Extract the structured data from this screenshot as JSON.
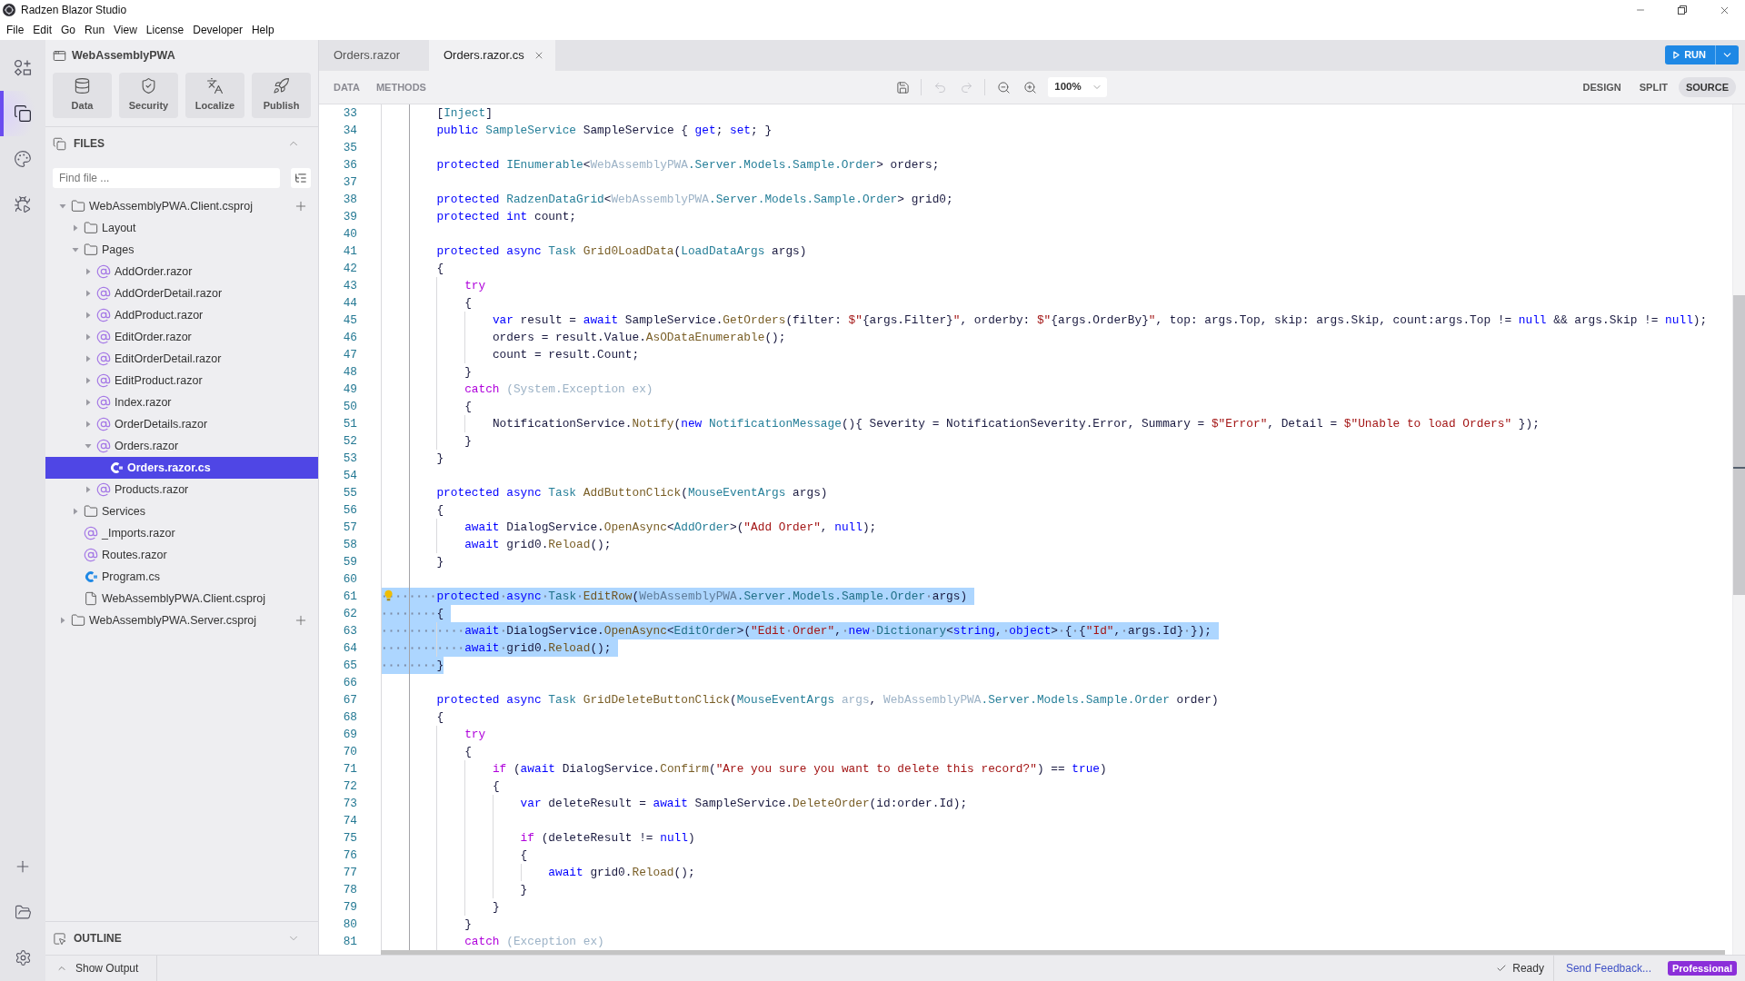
{
  "window": {
    "title": "Radzen Blazor Studio"
  },
  "menu": [
    "File",
    "Edit",
    "Go",
    "Run",
    "View",
    "License",
    "Developer",
    "Help"
  ],
  "activity_bar": {
    "items": [
      {
        "selected": false
      },
      {
        "selected": true
      },
      {
        "selected": false
      },
      {
        "selected": false
      }
    ]
  },
  "sidebar": {
    "project": "WebAssemblyPWA",
    "tools": [
      "Data",
      "Security",
      "Localize",
      "Publish"
    ],
    "files": {
      "title": "FILES",
      "expanded": true,
      "search": {
        "placeholder": "Find file ..."
      },
      "tree": [
        {
          "label": "WebAssemblyPWA.Client.csproj",
          "kind": "project",
          "expanded": true,
          "selected": false,
          "children": [
            {
              "label": "Layout",
              "kind": "folder",
              "expanded": false,
              "selected": false
            },
            {
              "label": "Pages",
              "kind": "folder",
              "expanded": true,
              "selected": false,
              "children": [
                {
                  "label": "AddOrder.razor",
                  "kind": "razor",
                  "expanded": false,
                  "selected": false
                },
                {
                  "label": "AddOrderDetail.razor",
                  "kind": "razor",
                  "expanded": false,
                  "selected": false
                },
                {
                  "label": "AddProduct.razor",
                  "kind": "razor",
                  "expanded": false,
                  "selected": false
                },
                {
                  "label": "EditOrder.razor",
                  "kind": "razor",
                  "expanded": false,
                  "selected": false
                },
                {
                  "label": "EditOrderDetail.razor",
                  "kind": "razor",
                  "expanded": false,
                  "selected": false
                },
                {
                  "label": "EditProduct.razor",
                  "kind": "razor",
                  "expanded": false,
                  "selected": false
                },
                {
                  "label": "Index.razor",
                  "kind": "razor",
                  "expanded": false,
                  "selected": false
                },
                {
                  "label": "OrderDetails.razor",
                  "kind": "razor",
                  "expanded": false,
                  "selected": false
                },
                {
                  "label": "Orders.razor",
                  "kind": "razor",
                  "expanded": true,
                  "selected": false,
                  "children": [
                    {
                      "label": "Orders.razor.cs",
                      "kind": "csharp",
                      "selected": true
                    }
                  ]
                },
                {
                  "label": "Products.razor",
                  "kind": "razor",
                  "expanded": false,
                  "selected": false
                }
              ]
            },
            {
              "label": "Services",
              "kind": "folder",
              "expanded": false,
              "selected": false
            },
            {
              "label": "_Imports.razor",
              "kind": "razor",
              "selected": false
            },
            {
              "label": "Routes.razor",
              "kind": "razor",
              "selected": false
            },
            {
              "label": "Program.cs",
              "kind": "csharp",
              "selected": false
            },
            {
              "label": "WebAssemblyPWA.Client.csproj",
              "kind": "file",
              "selected": false
            }
          ]
        },
        {
          "label": "WebAssemblyPWA.Server.csproj",
          "kind": "project",
          "expanded": false,
          "selected": false
        }
      ]
    },
    "outline": {
      "title": "OUTLINE",
      "expanded": false
    }
  },
  "editor": {
    "tabs": [
      {
        "label": "Orders.razor",
        "selected": false
      },
      {
        "label": "Orders.razor.cs",
        "selected": true
      }
    ],
    "run_button": {
      "label": "RUN"
    },
    "toolbar": {
      "links": [
        "DATA",
        "METHODS"
      ],
      "undo": {
        "disabled": true
      },
      "redo": {
        "disabled": true
      },
      "zoom": "100%",
      "views": [
        {
          "label": "DESIGN",
          "selected": false
        },
        {
          "label": "SPLIT",
          "selected": false
        },
        {
          "label": "SOURCE",
          "selected": true
        }
      ]
    },
    "lines": [
      {
        "number": "33",
        "selected": false,
        "lightbulb": false,
        "tokens": [
          {
            "kind": "plain",
            "text": "        ["
          },
          {
            "kind": "type",
            "text": "Inject"
          },
          {
            "kind": "plain",
            "text": "]"
          }
        ]
      },
      {
        "number": "34",
        "selected": false,
        "lightbulb": false,
        "tokens": [
          {
            "kind": "keyword",
            "text": "        public "
          },
          {
            "kind": "type",
            "text": "SampleService"
          },
          {
            "kind": "plain",
            "text": " SampleService { "
          },
          {
            "kind": "keyword",
            "text": "get"
          },
          {
            "kind": "plain",
            "text": "; "
          },
          {
            "kind": "keyword",
            "text": "set"
          },
          {
            "kind": "plain",
            "text": "; }"
          }
        ]
      },
      {
        "number": "35",
        "selected": false,
        "lightbulb": false
      },
      {
        "number": "36",
        "selected": false,
        "lightbulb": false,
        "tokens": [
          {
            "kind": "keyword",
            "text": "        protected "
          },
          {
            "kind": "type",
            "text": "IEnumerable"
          },
          {
            "kind": "plain",
            "text": "<"
          },
          {
            "kind": "faded",
            "text": "WebAssemblyPWA"
          },
          {
            "kind": "type",
            "text": ".Server.Models.Sample.Order"
          },
          {
            "kind": "plain",
            "text": "> orders;"
          }
        ]
      },
      {
        "number": "37",
        "selected": false,
        "lightbulb": false
      },
      {
        "number": "38",
        "selected": false,
        "lightbulb": false,
        "tokens": [
          {
            "kind": "keyword",
            "text": "        protected "
          },
          {
            "kind": "type",
            "text": "RadzenDataGrid"
          },
          {
            "kind": "plain",
            "text": "<"
          },
          {
            "kind": "faded",
            "text": "WebAssemblyPWA"
          },
          {
            "kind": "type",
            "text": ".Server.Models.Sample.Order"
          },
          {
            "kind": "plain",
            "text": "> grid0;"
          }
        ]
      },
      {
        "number": "39",
        "selected": false,
        "lightbulb": false,
        "tokens": [
          {
            "kind": "keyword",
            "text": "        protected int "
          },
          {
            "kind": "plain",
            "text": "count;"
          }
        ]
      },
      {
        "number": "40",
        "selected": false,
        "lightbulb": false
      },
      {
        "number": "41",
        "selected": false,
        "lightbulb": false,
        "tokens": [
          {
            "kind": "keyword",
            "text": "        protected async "
          },
          {
            "kind": "type",
            "text": "Task "
          },
          {
            "kind": "method",
            "text": "Grid0LoadData"
          },
          {
            "kind": "plain",
            "text": "("
          },
          {
            "kind": "type",
            "text": "LoadDataArgs"
          },
          {
            "kind": "plain",
            "text": " args)"
          }
        ]
      },
      {
        "number": "42",
        "selected": false,
        "lightbulb": false,
        "tokens": [
          {
            "kind": "plain",
            "text": "        {"
          }
        ]
      },
      {
        "number": "43",
        "selected": false,
        "lightbulb": false,
        "tokens": [
          {
            "kind": "control",
            "text": "            try"
          }
        ]
      },
      {
        "number": "44",
        "selected": false,
        "lightbulb": false,
        "tokens": [
          {
            "kind": "plain",
            "text": "            {"
          }
        ]
      },
      {
        "number": "45",
        "selected": false,
        "lightbulb": false,
        "tokens": [
          {
            "kind": "keyword",
            "text": "                var "
          },
          {
            "kind": "plain",
            "text": "result = "
          },
          {
            "kind": "keyword",
            "text": "await "
          },
          {
            "kind": "plain",
            "text": "SampleService."
          },
          {
            "kind": "method",
            "text": "GetOrders"
          },
          {
            "kind": "plain",
            "text": "(filter: "
          },
          {
            "kind": "string",
            "text": "$\""
          },
          {
            "kind": "plain",
            "text": "{args.Filter}"
          },
          {
            "kind": "string",
            "text": "\""
          },
          {
            "kind": "plain",
            "text": ", orderby: "
          },
          {
            "kind": "string",
            "text": "$\""
          },
          {
            "kind": "plain",
            "text": "{args.OrderBy}"
          },
          {
            "kind": "string",
            "text": "\""
          },
          {
            "kind": "plain",
            "text": ", top: args.Top, skip: args.Skip, count:args.Top != "
          },
          {
            "kind": "keyword",
            "text": "null"
          },
          {
            "kind": "plain",
            "text": " && args.Skip != "
          },
          {
            "kind": "keyword",
            "text": "null"
          },
          {
            "kind": "plain",
            "text": ");"
          }
        ]
      },
      {
        "number": "46",
        "selected": false,
        "lightbulb": false,
        "tokens": [
          {
            "kind": "plain",
            "text": "                orders = result.Value."
          },
          {
            "kind": "method",
            "text": "AsODataEnumerable"
          },
          {
            "kind": "plain",
            "text": "();"
          }
        ]
      },
      {
        "number": "47",
        "selected": false,
        "lightbulb": false,
        "tokens": [
          {
            "kind": "plain",
            "text": "                count = result.Count;"
          }
        ]
      },
      {
        "number": "48",
        "selected": false,
        "lightbulb": false,
        "tokens": [
          {
            "kind": "plain",
            "text": "            }"
          }
        ]
      },
      {
        "number": "49",
        "selected": false,
        "lightbulb": false,
        "tokens": [
          {
            "kind": "control",
            "text": "            catch "
          },
          {
            "kind": "faded",
            "text": "(System.Exception ex)"
          }
        ]
      },
      {
        "number": "50",
        "selected": false,
        "lightbulb": false,
        "tokens": [
          {
            "kind": "plain",
            "text": "            {"
          }
        ]
      },
      {
        "number": "51",
        "selected": false,
        "lightbulb": false,
        "tokens": [
          {
            "kind": "plain",
            "text": "                NotificationService."
          },
          {
            "kind": "method",
            "text": "Notify"
          },
          {
            "kind": "plain",
            "text": "("
          },
          {
            "kind": "keyword",
            "text": "new "
          },
          {
            "kind": "type",
            "text": "NotificationMessage"
          },
          {
            "kind": "plain",
            "text": "(){ Severity = NotificationSeverity.Error, Summary = "
          },
          {
            "kind": "string",
            "text": "$\"Error\""
          },
          {
            "kind": "plain",
            "text": ", Detail = "
          },
          {
            "kind": "string",
            "text": "$\"Unable to load Orders\""
          },
          {
            "kind": "plain",
            "text": " });"
          }
        ]
      },
      {
        "number": "52",
        "selected": false,
        "lightbulb": false,
        "tokens": [
          {
            "kind": "plain",
            "text": "            }"
          }
        ]
      },
      {
        "number": "53",
        "selected": false,
        "lightbulb": false,
        "tokens": [
          {
            "kind": "plain",
            "text": "        }"
          }
        ]
      },
      {
        "number": "54",
        "selected": false,
        "lightbulb": false
      },
      {
        "number": "55",
        "selected": false,
        "lightbulb": false,
        "tokens": [
          {
            "kind": "keyword",
            "text": "        protected async "
          },
          {
            "kind": "type",
            "text": "Task "
          },
          {
            "kind": "method",
            "text": "AddButtonClick"
          },
          {
            "kind": "plain",
            "text": "("
          },
          {
            "kind": "type",
            "text": "MouseEventArgs"
          },
          {
            "kind": "plain",
            "text": " args)"
          }
        ]
      },
      {
        "number": "56",
        "selected": false,
        "lightbulb": false,
        "tokens": [
          {
            "kind": "plain",
            "text": "        {"
          }
        ]
      },
      {
        "number": "57",
        "selected": false,
        "lightbulb": false,
        "tokens": [
          {
            "kind": "keyword",
            "text": "            await "
          },
          {
            "kind": "plain",
            "text": "DialogService."
          },
          {
            "kind": "method",
            "text": "OpenAsync"
          },
          {
            "kind": "plain",
            "text": "<"
          },
          {
            "kind": "type",
            "text": "AddOrder"
          },
          {
            "kind": "plain",
            "text": ">("
          },
          {
            "kind": "string",
            "text": "\"Add Order\""
          },
          {
            "kind": "plain",
            "text": ", "
          },
          {
            "kind": "keyword",
            "text": "null"
          },
          {
            "kind": "plain",
            "text": ");"
          }
        ]
      },
      {
        "number": "58",
        "selected": false,
        "lightbulb": false,
        "tokens": [
          {
            "kind": "keyword",
            "text": "            await "
          },
          {
            "kind": "plain",
            "text": "grid0."
          },
          {
            "kind": "method",
            "text": "Reload"
          },
          {
            "kind": "plain",
            "text": "();"
          }
        ]
      },
      {
        "number": "59",
        "selected": false,
        "lightbulb": false,
        "tokens": [
          {
            "kind": "plain",
            "text": "        }"
          }
        ]
      },
      {
        "number": "60",
        "selected": false,
        "lightbulb": false
      },
      {
        "number": "61",
        "selected": true,
        "lightbulb": true,
        "tokens": [
          {
            "kind": "keyword",
            "text": "        protected async "
          },
          {
            "kind": "type",
            "text": "Task "
          },
          {
            "kind": "method",
            "text": "EditRow"
          },
          {
            "kind": "plain",
            "text": "("
          },
          {
            "kind": "faded",
            "text": "WebAssemblyPWA"
          },
          {
            "kind": "type",
            "text": ".Server.Models.Sample.Order"
          },
          {
            "kind": "plain",
            "text": " args)"
          }
        ]
      },
      {
        "number": "62",
        "selected": true,
        "lightbulb": false,
        "tokens": [
          {
            "kind": "plain",
            "text": "        {"
          }
        ]
      },
      {
        "number": "63",
        "selected": true,
        "lightbulb": false,
        "tokens": [
          {
            "kind": "keyword",
            "text": "            await "
          },
          {
            "kind": "plain",
            "text": "DialogService."
          },
          {
            "kind": "method",
            "text": "OpenAsync"
          },
          {
            "kind": "plain",
            "text": "<"
          },
          {
            "kind": "type",
            "text": "EditOrder"
          },
          {
            "kind": "plain",
            "text": ">("
          },
          {
            "kind": "string",
            "text": "\"Edit Order\""
          },
          {
            "kind": "plain",
            "text": ", "
          },
          {
            "kind": "keyword",
            "text": "new "
          },
          {
            "kind": "type",
            "text": "Dictionary"
          },
          {
            "kind": "plain",
            "text": "<"
          },
          {
            "kind": "keyword",
            "text": "string"
          },
          {
            "kind": "plain",
            "text": ", "
          },
          {
            "kind": "keyword",
            "text": "object"
          },
          {
            "kind": "plain",
            "text": "> { {"
          },
          {
            "kind": "string",
            "text": "\"Id\""
          },
          {
            "kind": "plain",
            "text": ", args.Id} });"
          }
        ]
      },
      {
        "number": "64",
        "selected": true,
        "lightbulb": false,
        "tokens": [
          {
            "kind": "keyword",
            "text": "            await "
          },
          {
            "kind": "plain",
            "text": "grid0."
          },
          {
            "kind": "method",
            "text": "Reload"
          },
          {
            "kind": "plain",
            "text": "();"
          }
        ]
      },
      {
        "number": "65",
        "selected": true,
        "lightbulb": false,
        "tokens": [
          {
            "kind": "plain",
            "text": "        }"
          }
        ]
      },
      {
        "number": "66",
        "selected": false,
        "lightbulb": false
      },
      {
        "number": "67",
        "selected": false,
        "lightbulb": false,
        "tokens": [
          {
            "kind": "keyword",
            "text": "        protected async "
          },
          {
            "kind": "type",
            "text": "Task "
          },
          {
            "kind": "method",
            "text": "GridDeleteButtonClick"
          },
          {
            "kind": "plain",
            "text": "("
          },
          {
            "kind": "type",
            "text": "MouseEventArgs "
          },
          {
            "kind": "faded",
            "text": "args"
          },
          {
            "kind": "plain",
            "text": ", "
          },
          {
            "kind": "faded",
            "text": "WebAssemblyPWA"
          },
          {
            "kind": "type",
            "text": ".Server.Models.Sample.Order"
          },
          {
            "kind": "plain",
            "text": " order)"
          }
        ]
      },
      {
        "number": "68",
        "selected": false,
        "lightbulb": false,
        "tokens": [
          {
            "kind": "plain",
            "text": "        {"
          }
        ]
      },
      {
        "number": "69",
        "selected": false,
        "lightbulb": false,
        "tokens": [
          {
            "kind": "control",
            "text": "            try"
          }
        ]
      },
      {
        "number": "70",
        "selected": false,
        "lightbulb": false,
        "tokens": [
          {
            "kind": "plain",
            "text": "            {"
          }
        ]
      },
      {
        "number": "71",
        "selected": false,
        "lightbulb": false,
        "tokens": [
          {
            "kind": "control",
            "text": "                if "
          },
          {
            "kind": "plain",
            "text": "("
          },
          {
            "kind": "keyword",
            "text": "await "
          },
          {
            "kind": "plain",
            "text": "DialogService."
          },
          {
            "kind": "method",
            "text": "Confirm"
          },
          {
            "kind": "plain",
            "text": "("
          },
          {
            "kind": "string",
            "text": "\"Are you sure you want to delete this record?\""
          },
          {
            "kind": "plain",
            "text": ") == "
          },
          {
            "kind": "keyword",
            "text": "true"
          },
          {
            "kind": "plain",
            "text": ")"
          }
        ]
      },
      {
        "number": "72",
        "selected": false,
        "lightbulb": false,
        "tokens": [
          {
            "kind": "plain",
            "text": "                {"
          }
        ]
      },
      {
        "number": "73",
        "selected": false,
        "lightbulb": false,
        "tokens": [
          {
            "kind": "keyword",
            "text": "                    var "
          },
          {
            "kind": "plain",
            "text": "deleteResult = "
          },
          {
            "kind": "keyword",
            "text": "await "
          },
          {
            "kind": "plain",
            "text": "SampleService."
          },
          {
            "kind": "method",
            "text": "DeleteOrder"
          },
          {
            "kind": "plain",
            "text": "(id:order.Id);"
          }
        ]
      },
      {
        "number": "74",
        "selected": false,
        "lightbulb": false
      },
      {
        "number": "75",
        "selected": false,
        "lightbulb": false,
        "tokens": [
          {
            "kind": "control",
            "text": "                    if "
          },
          {
            "kind": "plain",
            "text": "(deleteResult != "
          },
          {
            "kind": "keyword",
            "text": "null"
          },
          {
            "kind": "plain",
            "text": ")"
          }
        ]
      },
      {
        "number": "76",
        "selected": false,
        "lightbulb": false,
        "tokens": [
          {
            "kind": "plain",
            "text": "                    {"
          }
        ]
      },
      {
        "number": "77",
        "selected": false,
        "lightbulb": false,
        "tokens": [
          {
            "kind": "keyword",
            "text": "                        await "
          },
          {
            "kind": "plain",
            "text": "grid0."
          },
          {
            "kind": "method",
            "text": "Reload"
          },
          {
            "kind": "plain",
            "text": "();"
          }
        ]
      },
      {
        "number": "78",
        "selected": false,
        "lightbulb": false,
        "tokens": [
          {
            "kind": "plain",
            "text": "                    }"
          }
        ]
      },
      {
        "number": "79",
        "selected": false,
        "lightbulb": false,
        "tokens": [
          {
            "kind": "plain",
            "text": "                }"
          }
        ]
      },
      {
        "number": "80",
        "selected": false,
        "lightbulb": false,
        "tokens": [
          {
            "kind": "plain",
            "text": "            }"
          }
        ]
      },
      {
        "number": "81",
        "selected": false,
        "lightbulb": false,
        "tokens": [
          {
            "kind": "control",
            "text": "            catch "
          },
          {
            "kind": "faded",
            "text": "(Exception ex)"
          }
        ]
      }
    ]
  },
  "status_bar": {
    "output": "Show Output",
    "status": "Ready",
    "feedback": "Send Feedback...",
    "license": "Professional"
  }
}
